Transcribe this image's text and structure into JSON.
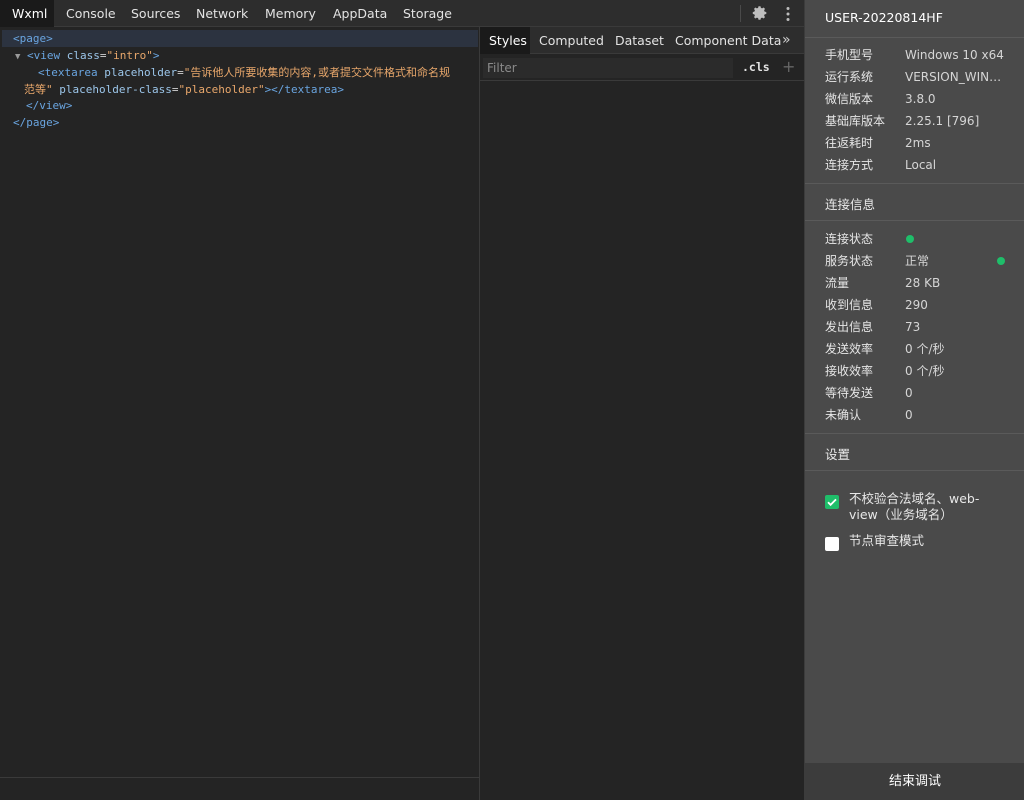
{
  "top_tabs": [
    "Wxml",
    "Console",
    "Sources",
    "Network",
    "Memory",
    "AppData",
    "Storage"
  ],
  "active_top_tab": "Wxml",
  "wxml": {
    "page_open": "<page>",
    "view_open_tag": "<view",
    "view_attr": "class",
    "view_value": "\"intro\"",
    "view_close": ">",
    "ta_tag": "<textarea",
    "ta_attr1": "placeholder",
    "ta_val1_a": "\"告诉他人所要收集的内容,或者提交文件格式和命名规",
    "ta_val1_b": "范等\"",
    "ta_attr2": "placeholder-class",
    "ta_val2": "\"placeholder\"",
    "ta_end": "></textarea>",
    "view_end": "</view>",
    "page_end": "</page>"
  },
  "style_tabs": [
    "Styles",
    "Computed",
    "Dataset",
    "Component Data"
  ],
  "active_style_tab": "Styles",
  "filter_placeholder": "Filter",
  "cls_label": ".cls",
  "panel": {
    "device_name": "USER-20220814HF",
    "info": [
      {
        "key": "手机型号",
        "value": "Windows 10 x64"
      },
      {
        "key": "运行系统",
        "value": "VERSION_WIN_L..."
      },
      {
        "key": "微信版本",
        "value": "3.8.0"
      },
      {
        "key": "基础库版本",
        "value": "2.25.1 [796]"
      },
      {
        "key": "往返耗时",
        "value": "2ms"
      },
      {
        "key": "连接方式",
        "value": "Local"
      }
    ],
    "conn_title": "连接信息",
    "conn": [
      {
        "key": "连接状态",
        "value": ""
      },
      {
        "key": "服务状态",
        "value": "正常"
      },
      {
        "key": "流量",
        "value": "28 KB"
      },
      {
        "key": "收到信息",
        "value": "290"
      },
      {
        "key": "发出信息",
        "value": "73"
      },
      {
        "key": "发送效率",
        "value": "0 个/秒"
      },
      {
        "key": "接收效率",
        "value": "0 个/秒"
      },
      {
        "key": "等待发送",
        "value": "0"
      },
      {
        "key": "未确认",
        "value": "0"
      }
    ],
    "settings_title": "设置",
    "settings": [
      {
        "label": "不校验合法域名、web-view（业务域名）",
        "checked": true
      },
      {
        "label": "节点审查模式",
        "checked": false
      }
    ],
    "end_button": "结束调试"
  },
  "colors": {
    "accent": "#1fbe6a",
    "tag": "#6aa5e0",
    "string": "#e8a76b"
  }
}
